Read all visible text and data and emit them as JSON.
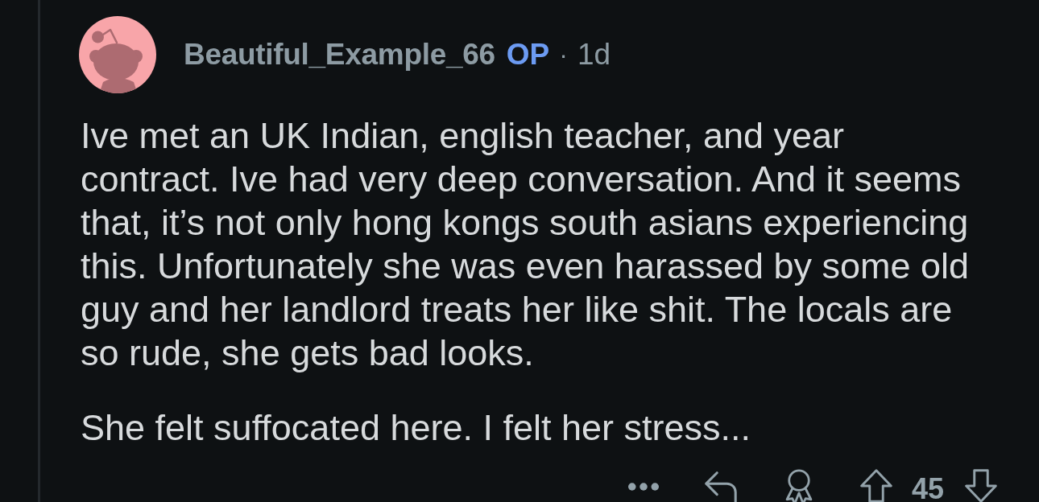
{
  "comment": {
    "author": "Beautiful_Example_66",
    "op_label": "OP",
    "separator": "·",
    "age": "1d",
    "paragraphs": [
      "Ive met an UK Indian, english teacher, and year contract. Ive had very deep conversation. And it seems that, it’s not only hong kongs south asians experiencing this. Unfortunately she was even harassed by some old guy and her landlord treats her like shit. The locals are so rude, she gets bad looks.",
      "She felt suffocated here. I felt her stress..."
    ],
    "score": "45"
  }
}
